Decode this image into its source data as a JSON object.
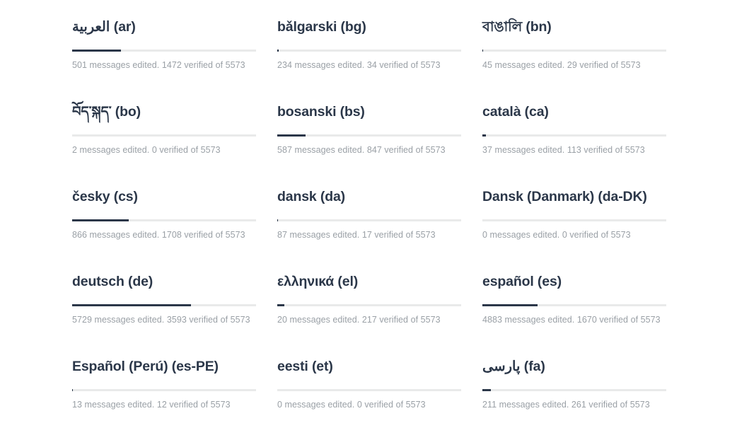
{
  "page": {
    "title": "Translation language list",
    "total_messages": 5573,
    "stats_template": "{edited} messages edited. {verified} verified of {total}",
    "colors": {
      "progress_fill": "#2b3749",
      "progress_track": "#e9eaea",
      "title_text": "#2b3749",
      "stats_text": "#9aa0a6",
      "background": "#ffffff"
    }
  },
  "languages": [
    {
      "name": "العربية (ar)",
      "code": "ar",
      "edited": 501,
      "verified": 1472,
      "total": 5573,
      "stats": "501 messages edited. 1472 verified of 5573",
      "progress_percent": 26.4
    },
    {
      "name": "bǎlgarski (bg)",
      "code": "bg",
      "edited": 234,
      "verified": 34,
      "total": 5573,
      "stats": "234 messages edited. 34 verified of 5573",
      "progress_percent": 0.6
    },
    {
      "name": "বাঙালি (bn)",
      "code": "bn",
      "edited": 45,
      "verified": 29,
      "total": 5573,
      "stats": "45 messages edited. 29 verified of 5573",
      "progress_percent": 0.5
    },
    {
      "name": "བོད་སྐད་ (bo)",
      "code": "bo",
      "edited": 2,
      "verified": 0,
      "total": 5573,
      "stats": "2 messages edited. 0 verified of 5573",
      "progress_percent": 0
    },
    {
      "name": "bosanski (bs)",
      "code": "bs",
      "edited": 587,
      "verified": 847,
      "total": 5573,
      "stats": "587 messages edited. 847 verified of 5573",
      "progress_percent": 15.2
    },
    {
      "name": "català (ca)",
      "code": "ca",
      "edited": 37,
      "verified": 113,
      "total": 5573,
      "stats": "37 messages edited. 113 verified of 5573",
      "progress_percent": 2.0
    },
    {
      "name": "česky (cs)",
      "code": "cs",
      "edited": 866,
      "verified": 1708,
      "total": 5573,
      "stats": "866 messages edited. 1708 verified of 5573",
      "progress_percent": 30.6
    },
    {
      "name": "dansk (da)",
      "code": "da",
      "edited": 87,
      "verified": 17,
      "total": 5573,
      "stats": "87 messages edited. 17 verified of 5573",
      "progress_percent": 0.3
    },
    {
      "name": "Dansk (Danmark) (da-DK)",
      "code": "da-DK",
      "edited": 0,
      "verified": 0,
      "total": 5573,
      "stats": "0 messages edited. 0 verified of 5573",
      "progress_percent": 0
    },
    {
      "name": "deutsch (de)",
      "code": "de",
      "edited": 5729,
      "verified": 3593,
      "total": 5573,
      "stats": "5729 messages edited. 3593 verified of 5573",
      "progress_percent": 64.5
    },
    {
      "name": "ελληνικά (el)",
      "code": "el",
      "edited": 20,
      "verified": 217,
      "total": 5573,
      "stats": "20 messages edited. 217 verified of 5573",
      "progress_percent": 3.9
    },
    {
      "name": "español (es)",
      "code": "es",
      "edited": 4883,
      "verified": 1670,
      "total": 5573,
      "stats": "4883 messages edited. 1670 verified of 5573",
      "progress_percent": 30.0
    },
    {
      "name": "Español (Perú) (es-PE)",
      "code": "es-PE",
      "edited": 13,
      "verified": 12,
      "total": 5573,
      "stats": "13 messages edited. 12 verified of 5573",
      "progress_percent": 0.2
    },
    {
      "name": "eesti (et)",
      "code": "et",
      "edited": 0,
      "verified": 0,
      "total": 5573,
      "stats": "0 messages edited. 0 verified of 5573",
      "progress_percent": 0
    },
    {
      "name": "پارسی (fa)",
      "code": "fa",
      "edited": 211,
      "verified": 261,
      "total": 5573,
      "stats": "211 messages edited. 261 verified of 5573",
      "progress_percent": 4.7
    }
  ]
}
